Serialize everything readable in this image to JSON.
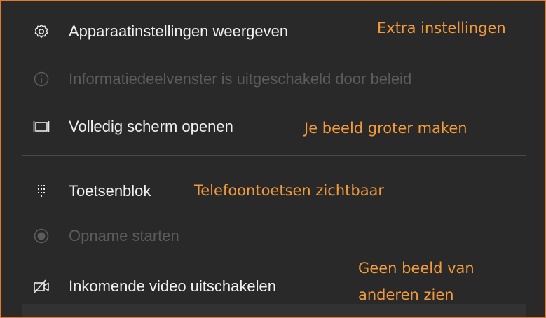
{
  "menu": {
    "items": [
      {
        "label": "Apparaatinstellingen weergeven",
        "icon": "gear-icon",
        "enabled": true
      },
      {
        "label": "Informatiedeelvenster is uitgeschakeld door beleid",
        "icon": "info-icon",
        "enabled": false
      },
      {
        "label": "Volledig scherm openen",
        "icon": "fullscreen-icon",
        "enabled": true
      },
      {
        "label": "Toetsenblok",
        "icon": "dialpad-icon",
        "enabled": true
      },
      {
        "label": "Opname starten",
        "icon": "record-icon",
        "enabled": false
      },
      {
        "label": "Inkomende video uitschakelen",
        "icon": "video-off-icon",
        "enabled": true
      }
    ]
  },
  "annotations": {
    "extra": "Extra instellingen",
    "fullscreen": "Je beeld groter maken",
    "dialpad": "Telefoontoetsen zichtbaar",
    "video_line1": "Geen beeld van",
    "video_line2": "anderen zien"
  },
  "colors": {
    "background": "#292929",
    "text": "#f0f0f0",
    "disabled_text": "#5c5c5c",
    "annotation": "#f39a3c",
    "border": "#e07a30"
  }
}
